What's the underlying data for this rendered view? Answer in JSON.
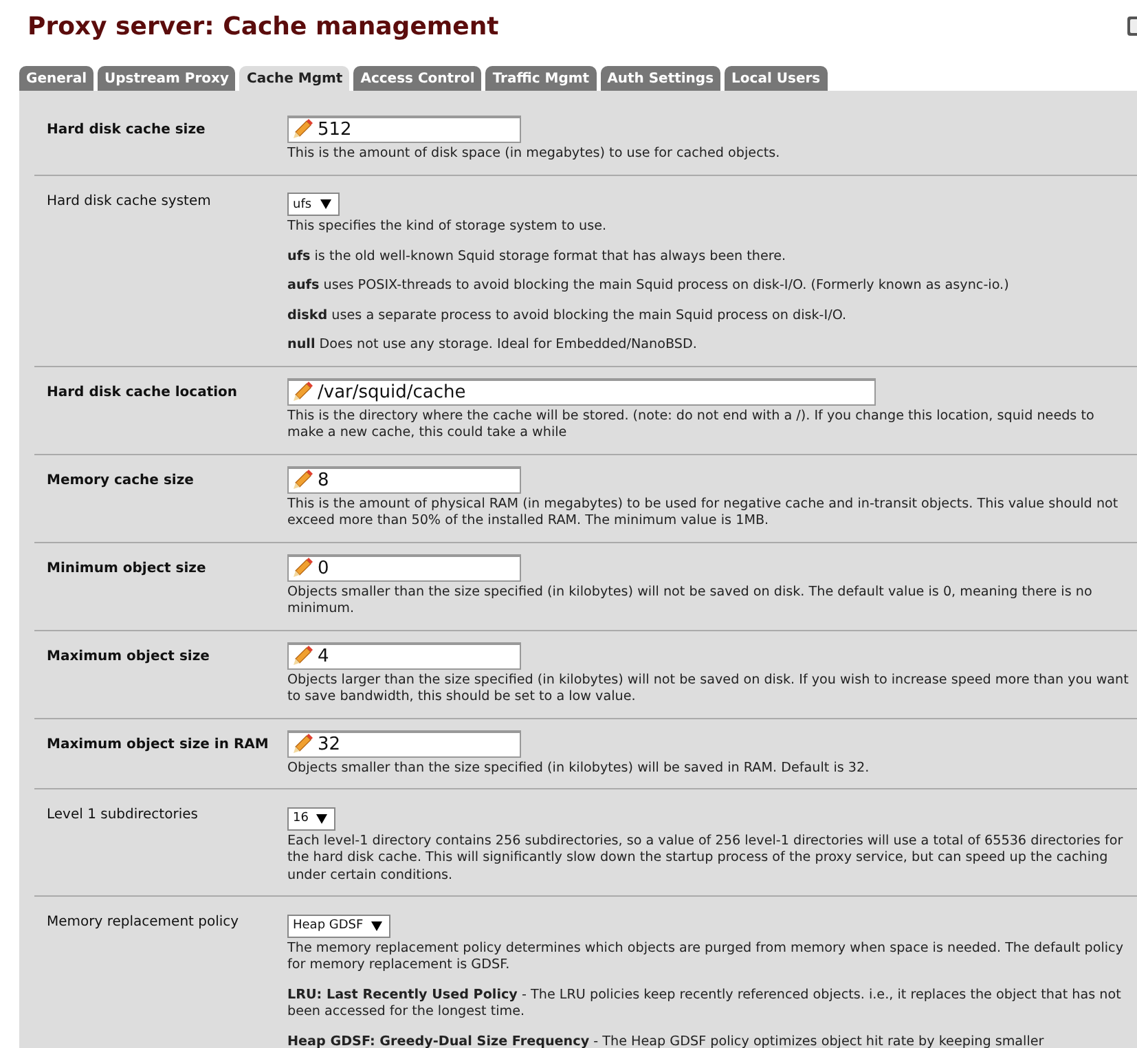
{
  "title": "Proxy server: Cache management",
  "tabs": [
    {
      "label": "General",
      "selected": false
    },
    {
      "label": "Upstream Proxy",
      "selected": false
    },
    {
      "label": "Cache Mgmt",
      "selected": true
    },
    {
      "label": "Access Control",
      "selected": false
    },
    {
      "label": "Traffic Mgmt",
      "selected": false
    },
    {
      "label": "Auth Settings",
      "selected": false
    },
    {
      "label": "Local Users",
      "selected": false
    }
  ],
  "rows": [
    {
      "label": "Hard disk cache size",
      "required": true,
      "kind": "text",
      "value": "512",
      "wide": false,
      "description": [
        "This is the amount of disk space (in megabytes) to use for cached objects."
      ]
    },
    {
      "label": "Hard disk cache system",
      "required": false,
      "kind": "select",
      "value": "ufs",
      "description": [
        "This specifies the kind of storage system to use.",
        "**ufs** is the old well-known Squid storage format that has always been there.",
        "**aufs** uses POSIX-threads to avoid blocking the main Squid process on disk-I/O. (Formerly known as async-io.)",
        "**diskd** uses a separate process to avoid blocking the main Squid process on disk-I/O.",
        "**null** Does not use any storage. Ideal for Embedded/NanoBSD."
      ]
    },
    {
      "label": "Hard disk cache location",
      "required": true,
      "kind": "text",
      "value": "/var/squid/cache",
      "wide": true,
      "description": [
        "This is the directory where the cache will be stored. (note: do not end with a /). If you change this location, squid needs to make a new cache, this could take a while"
      ]
    },
    {
      "label": "Memory cache size",
      "required": true,
      "kind": "text",
      "value": "8",
      "wide": false,
      "description": [
        "This is the amount of physical RAM (in megabytes) to be used for negative cache and in-transit objects. This value should not exceed more than 50% of the installed RAM. The minimum value is 1MB."
      ]
    },
    {
      "label": "Minimum object size",
      "required": true,
      "kind": "text",
      "value": "0",
      "wide": false,
      "description": [
        "Objects smaller than the size specified (in kilobytes) will not be saved on disk. The default value is 0, meaning there is no minimum."
      ]
    },
    {
      "label": "Maximum object size",
      "required": true,
      "kind": "text",
      "value": "4",
      "wide": false,
      "description": [
        "Objects larger than the size specified (in kilobytes) will not be saved on disk. If you wish to increase speed more than you want to save bandwidth, this should be set to a low value."
      ]
    },
    {
      "label": "Maximum object size in RAM",
      "required": true,
      "kind": "text",
      "value": "32",
      "wide": false,
      "description": [
        "Objects smaller than the size specified (in kilobytes) will be saved in RAM. Default is 32."
      ]
    },
    {
      "label": "Level 1 subdirectories",
      "required": false,
      "kind": "select",
      "value": "16",
      "description": [
        "Each level-1 directory contains 256 subdirectories, so a value of 256 level-1 directories will use a total of 65536 directories for the hard disk cache. This will significantly slow down the startup process of the proxy service, but can speed up the caching under certain conditions."
      ]
    },
    {
      "label": "Memory replacement policy",
      "required": false,
      "kind": "select",
      "value": "Heap GDSF",
      "description": [
        "The memory replacement policy determines which objects are purged from memory when space is needed. The default policy for memory replacement is GDSF.",
        "**LRU: Last Recently Used Policy** - The LRU policies keep recently referenced objects. i.e., it replaces the object that has not been accessed for the longest time.",
        "**Heap GDSF: Greedy-Dual Size Frequency** - The Heap GDSF policy optimizes object hit rate by keeping smaller"
      ]
    }
  ]
}
